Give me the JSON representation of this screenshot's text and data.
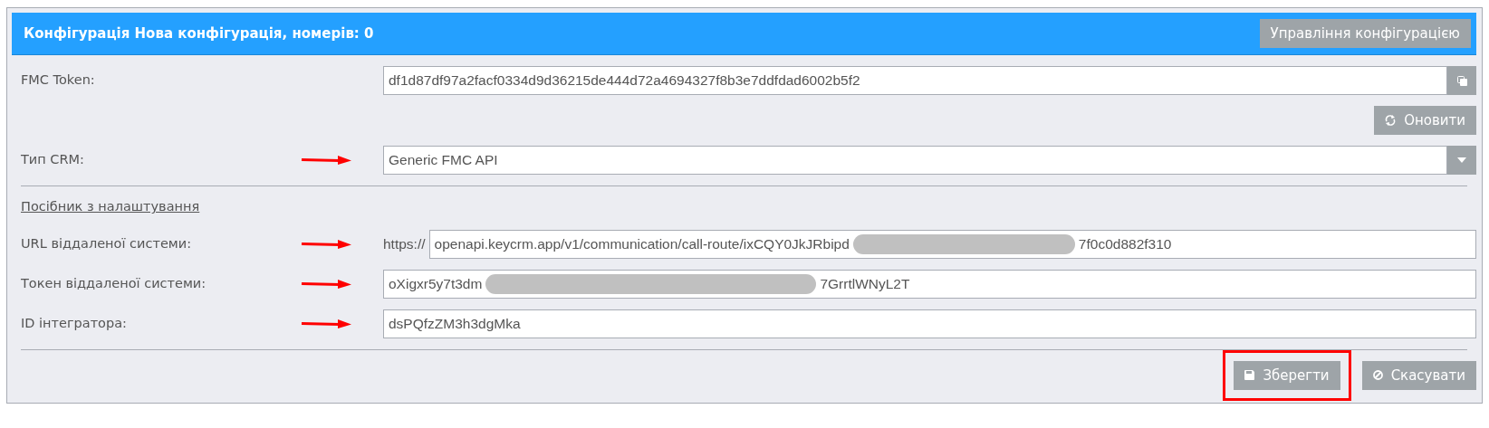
{
  "header": {
    "title": "Конфігурація Нова конфігурація, номерів: 0",
    "button": "Управління конфігурацією"
  },
  "fmc_token": {
    "label": "FMC Token:",
    "value": "df1d87df97a2facf0334d9d36215de444d72a4694327f8b3e7ddfdad6002b5f2"
  },
  "refresh_button": "Оновити",
  "crm_type": {
    "label": "Тип CRM:",
    "value": "Generic FMC API",
    "arrow": true
  },
  "guide_link": "Посібник з налаштування",
  "remote_fields": [
    {
      "kind": "prefixed",
      "label": "URL віддаленої системи:",
      "prefix": "https://",
      "value_parts": [
        "openapi.keycrm.app/v1/communication/call-route/ixCQY0JkJRbipd",
        "7f0c0d882f310"
      ],
      "arrow": true
    },
    {
      "kind": "plain",
      "label": "Токен віддаленої системи:",
      "value_parts": [
        "oXigxr5y7t3dm",
        "7GrrtlWNyL2T"
      ],
      "arrow": true
    },
    {
      "kind": "plain",
      "label": "ID інтегратора:",
      "value_parts": [
        "dsPQfzZM3h3dgMka"
      ],
      "arrow": true
    }
  ],
  "actions": [
    {
      "kind": "save",
      "label": "Зберегти",
      "highlighted": true
    },
    {
      "kind": "cancel",
      "label": "Скасувати",
      "highlighted": false
    }
  ]
}
